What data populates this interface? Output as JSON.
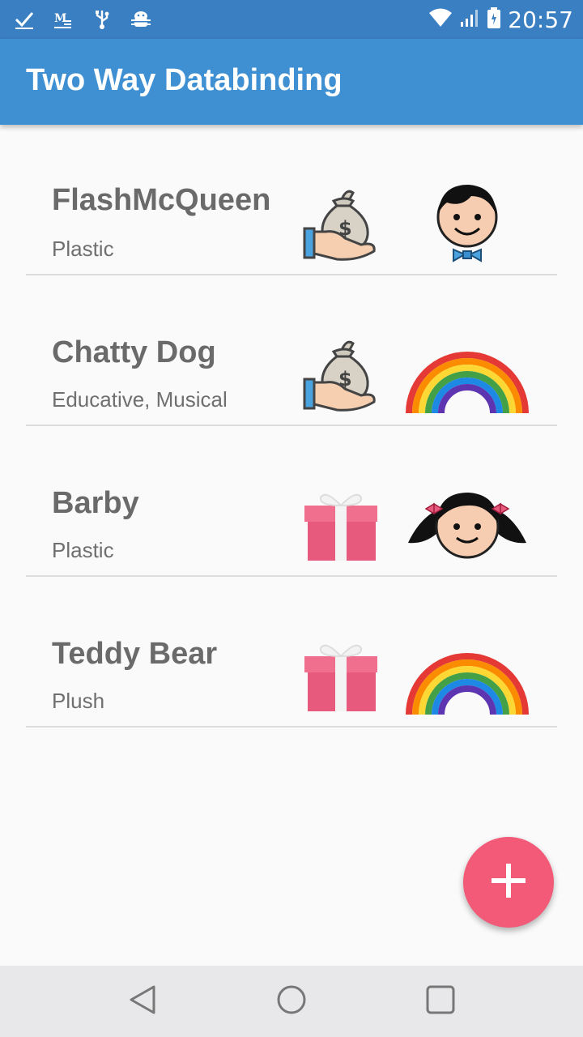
{
  "status_bar": {
    "time": "20:57",
    "left_icons": [
      "check-icon",
      "mail-icon",
      "usb-icon",
      "android-debug-icon"
    ],
    "right_icons": [
      "wifi-icon",
      "signal-icon",
      "battery-icon"
    ]
  },
  "app_bar": {
    "title": "Two Way Databinding"
  },
  "toys": [
    {
      "name": "FlashMcQueen",
      "categories": "Plastic",
      "price_icon": "money-bag-icon",
      "target_icon": "boy-icon"
    },
    {
      "name": "Chatty Dog",
      "categories": "Educative, Musical",
      "price_icon": "money-bag-icon",
      "target_icon": "rainbow-icon"
    },
    {
      "name": "Barby",
      "categories": "Plastic",
      "price_icon": "gift-icon",
      "target_icon": "girl-icon"
    },
    {
      "name": "Teddy Bear",
      "categories": "Plush",
      "price_icon": "gift-icon",
      "target_icon": "rainbow-icon"
    }
  ],
  "fab": {
    "icon": "plus-icon"
  },
  "nav_bar": {
    "buttons": [
      "back-icon",
      "home-icon",
      "recents-icon"
    ]
  },
  "colors": {
    "status_bar": "#3a7fc2",
    "app_bar": "#3f90d3",
    "fab": "#f25a78"
  }
}
